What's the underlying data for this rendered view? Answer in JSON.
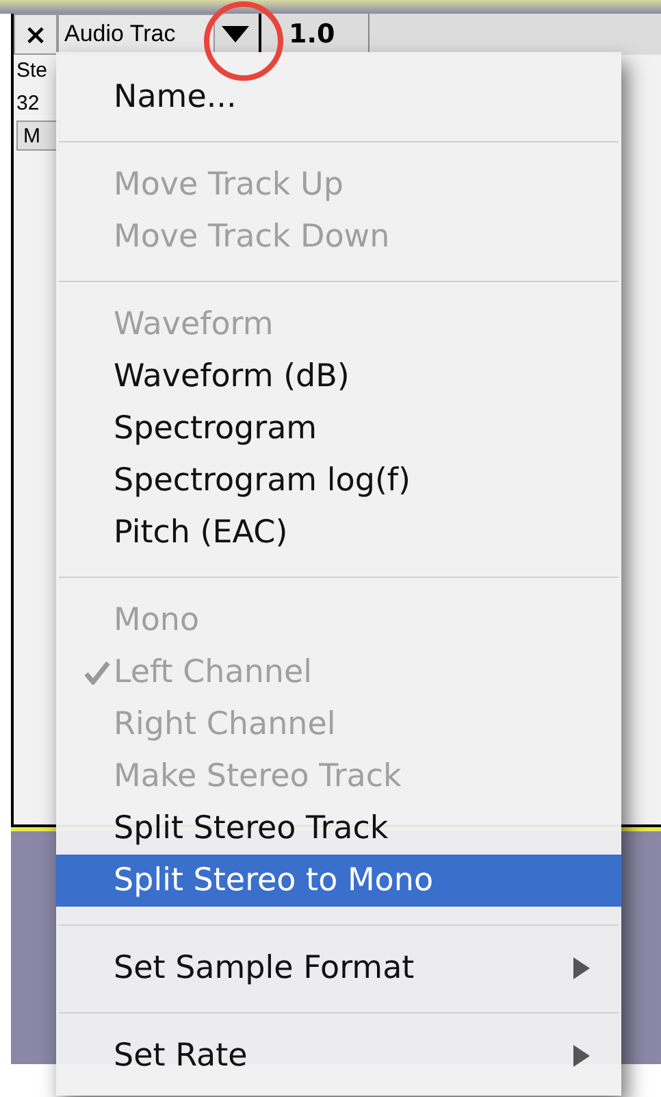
{
  "track": {
    "close": "×",
    "name": "Audio Trac",
    "ruler_label": "1.0",
    "info_lines": [
      "Ste",
      "32"
    ],
    "mute_fragment": "M"
  },
  "menu": {
    "sections": [
      {
        "items": [
          {
            "label": "Name...",
            "kind": "item",
            "disabled": false,
            "checked": false,
            "selected": false
          }
        ]
      },
      {
        "items": [
          {
            "label": "Move Track Up",
            "kind": "item",
            "disabled": true,
            "checked": false,
            "selected": false
          },
          {
            "label": "Move Track Down",
            "kind": "item",
            "disabled": true,
            "checked": false,
            "selected": false
          }
        ]
      },
      {
        "items": [
          {
            "label": "Waveform",
            "kind": "item",
            "disabled": true,
            "checked": false,
            "selected": false
          },
          {
            "label": "Waveform (dB)",
            "kind": "item",
            "disabled": false,
            "checked": false,
            "selected": false
          },
          {
            "label": "Spectrogram",
            "kind": "item",
            "disabled": false,
            "checked": false,
            "selected": false
          },
          {
            "label": "Spectrogram log(f)",
            "kind": "item",
            "disabled": false,
            "checked": false,
            "selected": false
          },
          {
            "label": "Pitch (EAC)",
            "kind": "item",
            "disabled": false,
            "checked": false,
            "selected": false
          }
        ]
      },
      {
        "items": [
          {
            "label": "Mono",
            "kind": "item",
            "disabled": true,
            "checked": false,
            "selected": false
          },
          {
            "label": "Left Channel",
            "kind": "item",
            "disabled": true,
            "checked": true,
            "selected": false
          },
          {
            "label": "Right Channel",
            "kind": "item",
            "disabled": true,
            "checked": false,
            "selected": false
          },
          {
            "label": "Make Stereo Track",
            "kind": "item",
            "disabled": true,
            "checked": false,
            "selected": false
          },
          {
            "label": "Split Stereo Track",
            "kind": "item",
            "disabled": false,
            "checked": false,
            "selected": false
          },
          {
            "label": "Split Stereo to Mono",
            "kind": "item",
            "disabled": false,
            "checked": false,
            "selected": true
          }
        ]
      },
      {
        "items": [
          {
            "label": "Set Sample Format",
            "kind": "submenu",
            "disabled": false,
            "checked": false,
            "selected": false
          }
        ]
      },
      {
        "items": [
          {
            "label": "Set Rate",
            "kind": "submenu",
            "disabled": false,
            "checked": false,
            "selected": false
          }
        ]
      }
    ]
  }
}
